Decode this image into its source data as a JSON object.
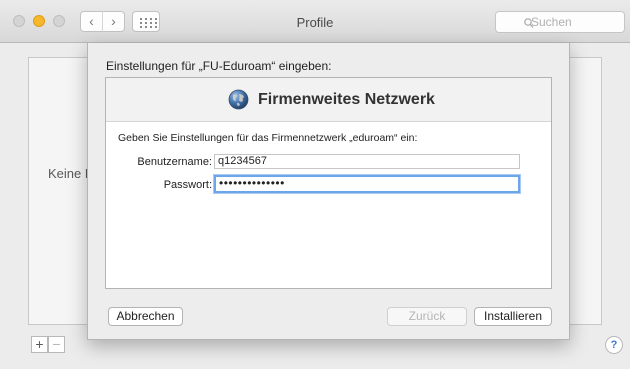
{
  "window": {
    "title": "Profile",
    "search_placeholder": "Suchen",
    "nav_back_icon": "‹",
    "nav_forward_icon": "›"
  },
  "background": {
    "empty_label": "Keine P",
    "add_button": "+",
    "remove_button": "−",
    "help_button": "?"
  },
  "sheet": {
    "heading": "Einstellungen für „FU-Eduroam“ eingeben:",
    "banner_title": "Firmenweites Netzwerk",
    "instruction": "Geben Sie Einstellungen für das Firmennetzwerk „eduroam“ ein:",
    "username_label": "Benutzername:",
    "username_value": "q1234567",
    "password_label": "Passwort:",
    "password_mask": "••••••••••••••"
  },
  "buttons": {
    "cancel": "Abbrechen",
    "back": "Zurück",
    "install": "Installieren"
  },
  "colors": {
    "focus_ring": "#6ca6ea",
    "minimize_light": "#f6b72a",
    "help_glyph": "#3b7bd6"
  }
}
